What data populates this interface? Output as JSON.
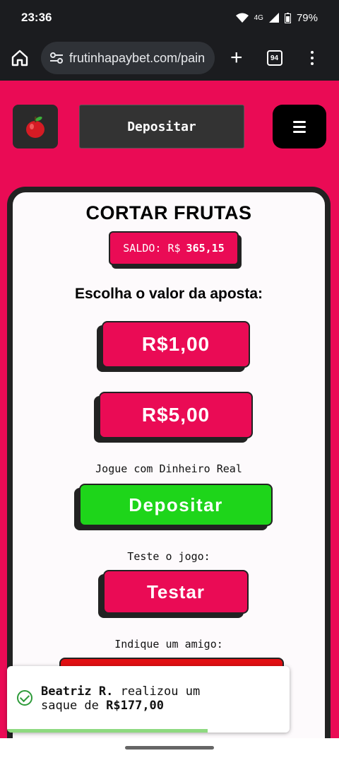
{
  "status_bar": {
    "time": "23:36",
    "network": "4G",
    "battery": "79%"
  },
  "browser": {
    "url": "frutinhapaybet.com/pain",
    "tab_count": "94"
  },
  "header": {
    "deposit_label": "Depositar"
  },
  "game": {
    "title": "CORTAR FRUTAS",
    "balance_label": "SALDO: R$",
    "balance_value": "365,15",
    "choose_label": "Escolha o valor da aposta:",
    "bet_1": "R$1,00",
    "bet_5": "R$5,00",
    "real_money_caption": "Jogue com Dinheiro Real",
    "deposit_button": "Depositar",
    "test_caption": "Teste o jogo:",
    "test_button": "Testar",
    "refer_caption": "Indique um amigo:"
  },
  "toast": {
    "name": "Beatriz R.",
    "text_mid": "realizou um",
    "text_pre": "saque de",
    "amount": "R$177,00",
    "progress": 0.71
  },
  "colors": {
    "brand": "#ea0b55",
    "deposit_green": "#1ed51a",
    "dark": "#222222"
  }
}
